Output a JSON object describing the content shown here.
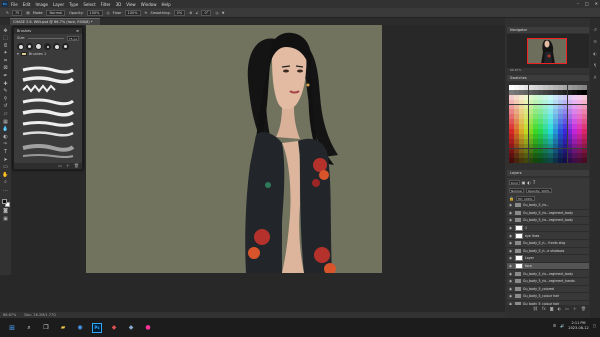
{
  "menu": {
    "items": [
      "File",
      "Edit",
      "Image",
      "Layer",
      "Type",
      "Select",
      "Filter",
      "3D",
      "View",
      "Window",
      "Help"
    ],
    "ps_label": "Ps",
    "window_controls": [
      "–",
      "□",
      "✕"
    ]
  },
  "options": {
    "size_value": "75",
    "mode_label": "Mode:",
    "mode_value": "Normal",
    "opacity_label": "Opacity:",
    "opacity_value": "100%",
    "flow_label": "Flow:",
    "flow_value": "100%",
    "smoothing_label": "Smoothing:",
    "smoothing_value": "0%",
    "angle_value": "0°"
  },
  "doc_tab": "CHASE 3.6. WIN.psd @ 66.7% (face, RGB/8) *",
  "brushes_panel": {
    "title": "Brushes",
    "size_label": "Size:",
    "size_value": "75 px",
    "folder_label": "Brushes 1"
  },
  "navigator_title": "Navigator",
  "navigator_zoom": "66.67%",
  "swatches_title": "Swatches",
  "layers_title": "Layers",
  "layers_kind": "Kind",
  "layers_mode": "Normal",
  "layers_opacity": "Opacity: 100%",
  "layers_fill": "Fill: 100%",
  "layers": [
    {
      "name": "Gu_body_5_ris...",
      "type": "folder"
    },
    {
      "name": "Gu_body_5_ris...regiment_body",
      "type": "folder"
    },
    {
      "name": "Gu_body_5_ris...regiment_body",
      "type": "folder"
    },
    {
      "name": "1",
      "type": "layer"
    },
    {
      "name": "eye lines",
      "type": "layer"
    },
    {
      "name": "Gu_body_5_ri... fronts stay",
      "type": "folder"
    },
    {
      "name": "Gu_body_5_ri...e shadows",
      "type": "folder"
    },
    {
      "name": "Layer",
      "type": "layer"
    },
    {
      "name": "face",
      "type": "layer",
      "selected": true
    },
    {
      "name": "Gu_body_5_ris...regiment_body",
      "type": "folder"
    },
    {
      "name": "Gu_body_5_ris...regiment_hands",
      "type": "folder"
    },
    {
      "name": "Gu_body_5_colored",
      "type": "folder"
    },
    {
      "name": "Gu_body_5_colour hair",
      "type": "folder"
    },
    {
      "name": "Gu_body_5_colour hair",
      "type": "folder"
    },
    {
      "name": "Gu_body_5_lines",
      "type": "folder"
    }
  ],
  "status": {
    "zoom": "66.67%",
    "doc": "Doc: 26.2M/1.77G"
  },
  "taskbar": {
    "time": "2:11 PM",
    "date": "2023-08-12"
  },
  "colors": {
    "canvas_bg": "#71735f",
    "ui_dark": "#282828",
    "panel": "#3b3b3b",
    "accent": "#31a8ff"
  }
}
